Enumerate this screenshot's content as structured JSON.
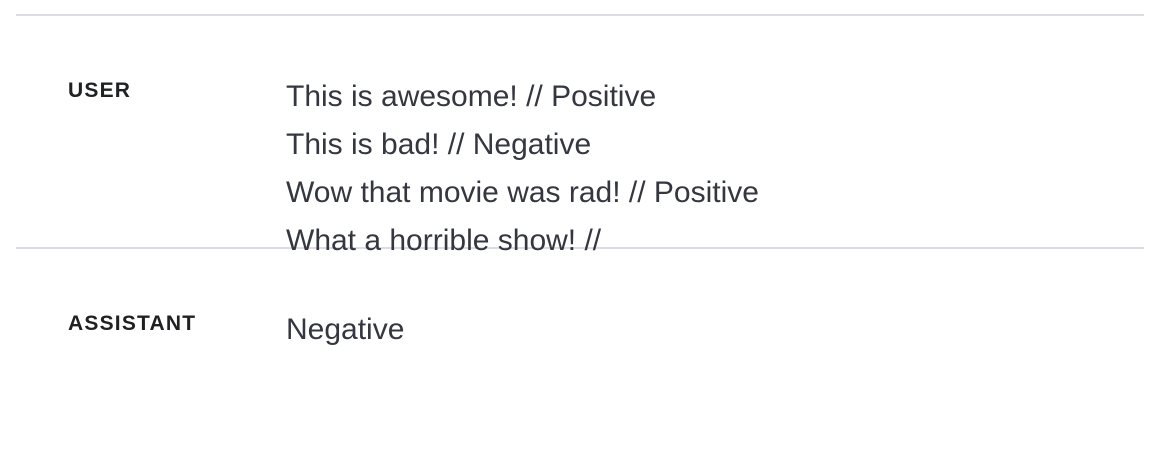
{
  "messages": [
    {
      "role": "USER",
      "lines": [
        "This is awesome! // Positive",
        "This is bad! // Negative",
        "Wow that movie was rad! // Positive",
        "What a horrible show! //"
      ]
    },
    {
      "role": "ASSISTANT",
      "lines": [
        "Negative"
      ]
    }
  ],
  "colors": {
    "text": "#353740",
    "role_text": "#202123",
    "divider": "#dcdde3",
    "background": "#ffffff"
  }
}
